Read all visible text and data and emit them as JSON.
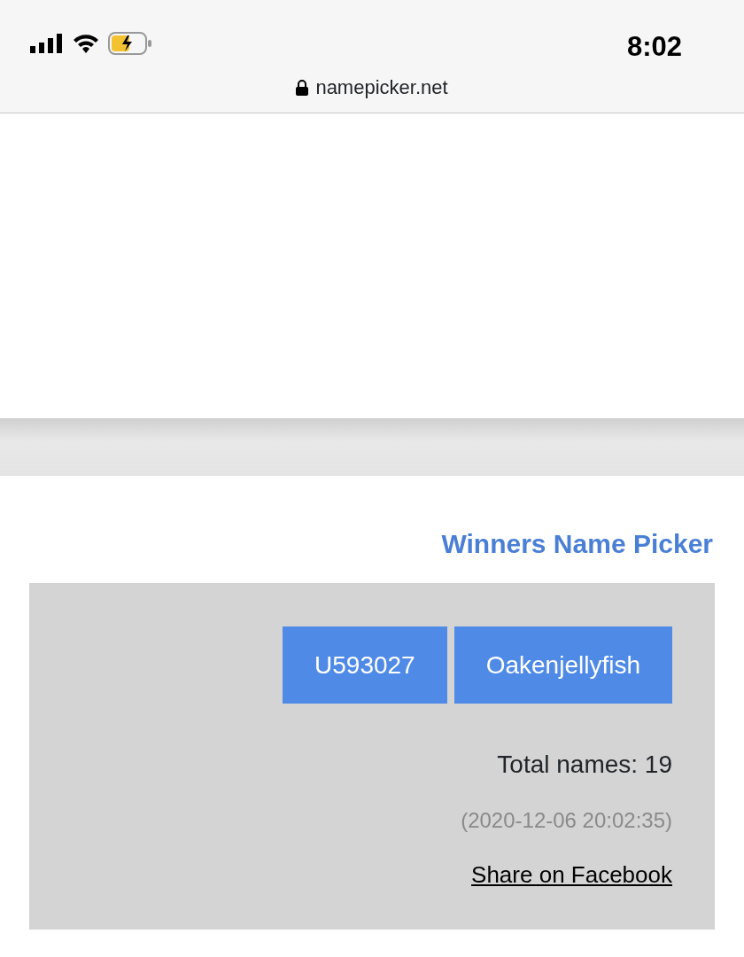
{
  "status_bar": {
    "time": "8:02"
  },
  "address_bar": {
    "url": "namepicker.net"
  },
  "title": "Winners Name Picker",
  "winners": [
    {
      "name": "U593027"
    },
    {
      "name": "Oakenjellyfish"
    }
  ],
  "total": "Total names: 19",
  "timestamp": "(2020-12-06 20:02:35)",
  "share_link": "Share on Facebook"
}
